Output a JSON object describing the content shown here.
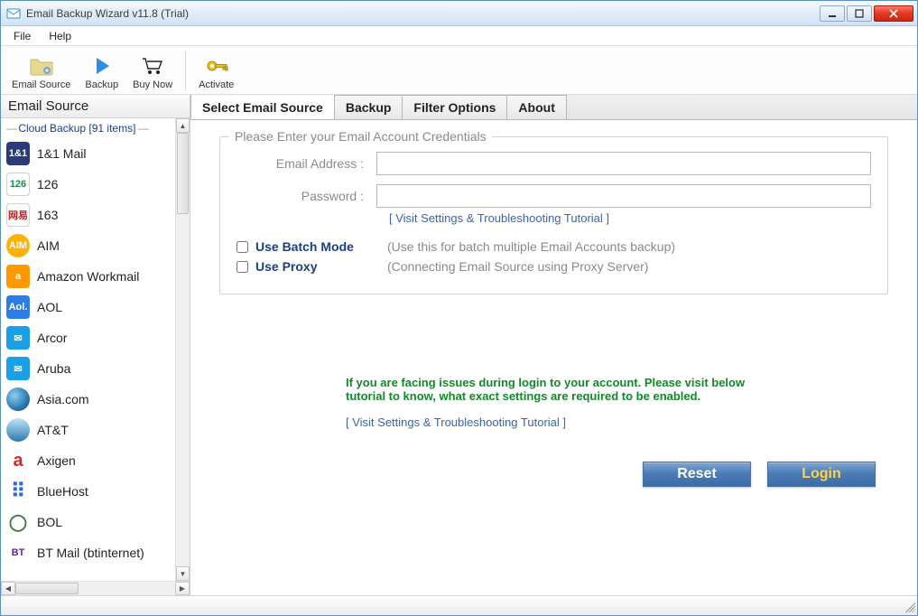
{
  "window": {
    "title": "Email Backup Wizard v11.8 (Trial)"
  },
  "menubar": {
    "items": [
      "File",
      "Help"
    ]
  },
  "toolbar": {
    "email_source": "Email Source",
    "backup": "Backup",
    "buy_now": "Buy Now",
    "activate": "Activate"
  },
  "left": {
    "title": "Email Source",
    "cloud_header": "Cloud Backup [91 items]",
    "items": [
      {
        "label": "1&1 Mail",
        "bg": "#2a3a7a",
        "txt": "1&1"
      },
      {
        "label": "126",
        "bg": "#fff",
        "txt": "126",
        "fg": "#1e8a4c",
        "border": "#d0d0d0"
      },
      {
        "label": "163",
        "bg": "#fff",
        "txt": "网易",
        "fg": "#c52121",
        "border": "#d0d0d0"
      },
      {
        "label": "AIM",
        "bg": "#ffb100",
        "txt": "AIM",
        "round": "50%"
      },
      {
        "label": "Amazon Workmail",
        "bg": "#ff9900",
        "txt": "a"
      },
      {
        "label": "AOL",
        "bg": "#2b7ee5",
        "txt": "Aol."
      },
      {
        "label": "Arcor",
        "bg": "#1aa0e6",
        "txt": "✉",
        "fg": "#fff"
      },
      {
        "label": "Aruba",
        "bg": "#1aa0e6",
        "txt": "✉",
        "fg": "#fff"
      },
      {
        "label": "Asia.com",
        "bg": "radial-gradient(circle at 35% 35%, #8fd0f0, #2a7ab0 60%, #0c3b5e)",
        "txt": "",
        "round": "50%"
      },
      {
        "label": "AT&T",
        "bg": "linear-gradient(to bottom, #bfe4f7, #2e7ab0)",
        "txt": "",
        "round": "50%"
      },
      {
        "label": "Axigen",
        "bg": "#fff",
        "txt": "a",
        "fg": "#d02b2b",
        "fs": "20px"
      },
      {
        "label": "BlueHost",
        "bg": "#fff",
        "txt": "⠿",
        "fg": "#2a6ad4",
        "fs": "22px"
      },
      {
        "label": "BOL",
        "bg": "#fff",
        "txt": "◯",
        "fg": "#3a7a3a",
        "fs": "18px"
      },
      {
        "label": "BT Mail (btinternet)",
        "bg": "#fff",
        "txt": "BT",
        "fg": "#5a2aa0"
      }
    ]
  },
  "tabs": {
    "items": [
      "Select Email Source",
      "Backup",
      "Filter Options",
      "About"
    ],
    "active": 0
  },
  "form": {
    "legend": "Please Enter your Email Account Credentials",
    "email_label": "Email Address :",
    "email_value": "",
    "password_label": "Password :",
    "password_value": "",
    "tutorial_link": "[ Visit Settings & Troubleshooting Tutorial ]",
    "batch_label": "Use Batch Mode",
    "batch_hint": "(Use this for batch multiple Email Accounts backup)",
    "proxy_label": "Use Proxy",
    "proxy_hint": "(Connecting Email Source using Proxy Server)"
  },
  "help": {
    "text": "If you are facing issues during login to your account. Please visit below tutorial to know, what exact settings are required to be enabled.",
    "link": "[ Visit Settings & Troubleshooting Tutorial ]"
  },
  "buttons": {
    "reset": "Reset",
    "login": "Login"
  }
}
